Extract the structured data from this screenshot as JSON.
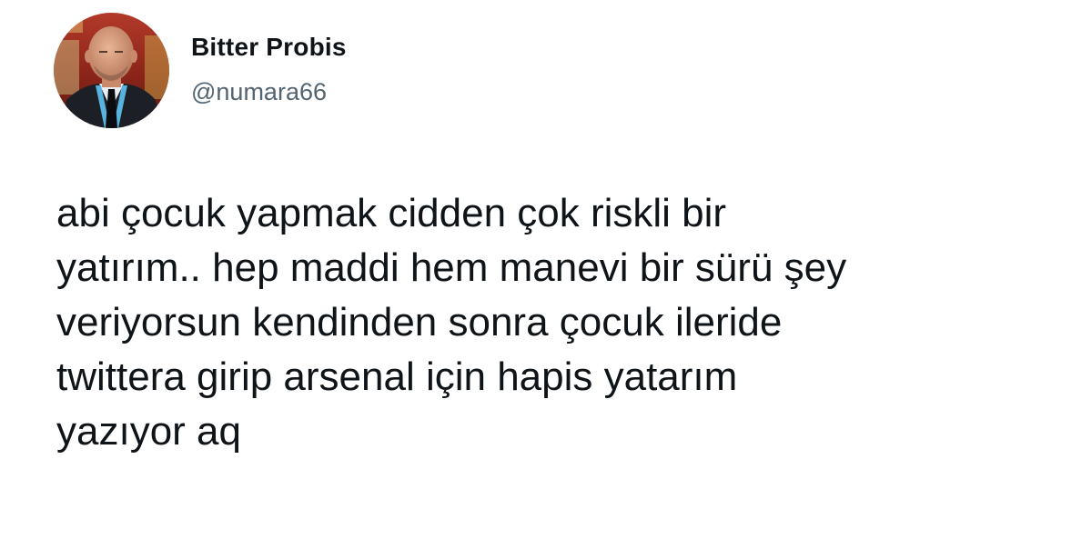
{
  "tweet": {
    "author": {
      "display_name": "Bitter Probis",
      "handle": "@numara66"
    },
    "text_lines": [
      "abi çocuk yapmak cidden çok riskli bir",
      "yatırım.. hep maddi hem manevi bir sürü şey",
      "veriyorsun kendinden sonra çocuk ileride",
      "twittera girip arsenal için hapis yatarım",
      "yazıyor aq"
    ]
  },
  "colors": {
    "text_primary": "#0f1419",
    "text_secondary": "#536471",
    "background": "#ffffff"
  }
}
